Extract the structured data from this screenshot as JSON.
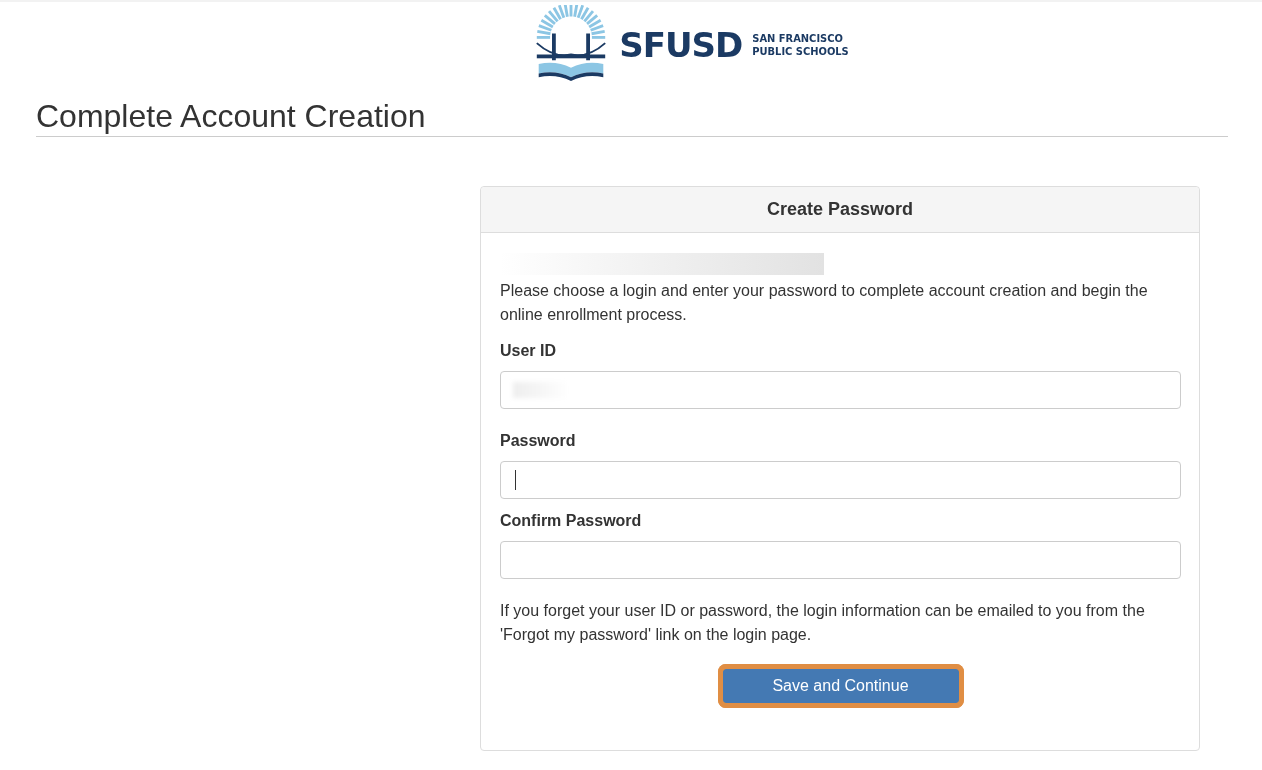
{
  "logo": {
    "wordmark": "SFUSD",
    "line_1": "SAN FRANCISCO",
    "line_2": "PUBLIC SCHOOLS"
  },
  "page_title": "Complete Account Creation",
  "panel": {
    "title": "Create Password",
    "redacted_line": true,
    "intro": "Please choose a login and enter your password to complete account creation and begin the online enrollment process.",
    "fields": [
      {
        "label": "User ID",
        "redacted_value": true,
        "focused": false
      },
      {
        "label": "Password",
        "redacted_value": false,
        "focused": true
      },
      {
        "label": "Confirm Password",
        "redacted_value": false,
        "focused": false
      }
    ],
    "note": "If you forget your user ID or password, the login information can be emailed to you from the 'Forgot my password' link on the login page.",
    "button": {
      "label": "Save and Continue",
      "highlighted": true
    }
  }
}
